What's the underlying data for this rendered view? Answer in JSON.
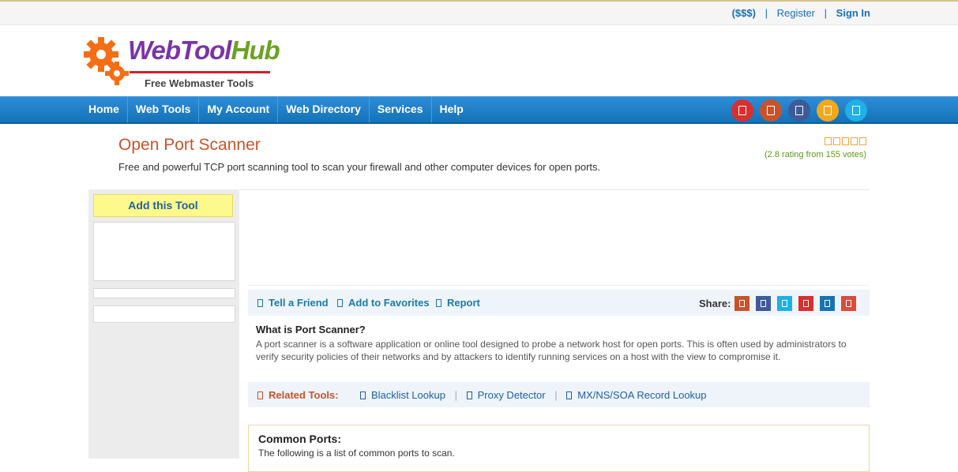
{
  "topbar": {
    "currency": "($$$)",
    "register": "Register",
    "signin": "Sign In",
    "sep": "|"
  },
  "logo": {
    "name_part1": "WebTool",
    "name_part2": "Hub",
    "tagline": "Free Webmaster Tools"
  },
  "nav": {
    "items": [
      {
        "label": "Home"
      },
      {
        "label": "Web Tools"
      },
      {
        "label": "My Account"
      },
      {
        "label": "Web Directory"
      },
      {
        "label": "Services"
      },
      {
        "label": "Help"
      }
    ],
    "social": [
      {
        "icon": "pinterest-icon",
        "color": "#d8302e"
      },
      {
        "icon": "rss-icon",
        "color": "#c8532b"
      },
      {
        "icon": "facebook-icon",
        "color": "#3f5a98"
      },
      {
        "icon": "bookmark-icon",
        "color": "#f2a81d"
      },
      {
        "icon": "twitter-icon",
        "color": "#1eb0e6"
      }
    ]
  },
  "page": {
    "title": "Open Port Scanner",
    "subtitle": "Free and powerful TCP port scanning tool to scan your firewall and other computer devices for open ports.",
    "rating_text": "(2.8 rating from 155 votes)",
    "stars": 5
  },
  "sidebar": {
    "add_tool": "Add this Tool"
  },
  "actions": {
    "tell_friend": "Tell a Friend",
    "favorites": "Add to Favorites",
    "report": "Report",
    "share_label": "Share:",
    "share": [
      {
        "icon": "reddit-icon",
        "color": "#c8532b"
      },
      {
        "icon": "facebook-icon",
        "color": "#3f5a98"
      },
      {
        "icon": "twitter-icon",
        "color": "#1eb0e6"
      },
      {
        "icon": "pinterest-icon",
        "color": "#d8302e"
      },
      {
        "icon": "linkedin-icon",
        "color": "#1a72b0"
      },
      {
        "icon": "google-plus-icon",
        "color": "#dd4b39"
      }
    ]
  },
  "description": {
    "title": "What is Port Scanner?",
    "body": "A port scanner is a software application or online tool designed to probe a network host for open ports. This is often used by administrators to verify security policies of their networks and by attackers to identify running services on a host with the view to compromise it."
  },
  "related": {
    "label": "Related Tools:",
    "links": [
      "Blacklist Lookup",
      "Proxy Detector",
      "MX/NS/SOA Record Lookup"
    ],
    "sep": "|"
  },
  "common_ports": {
    "title": "Common Ports:",
    "text": "The following is a list of common ports to scan."
  }
}
